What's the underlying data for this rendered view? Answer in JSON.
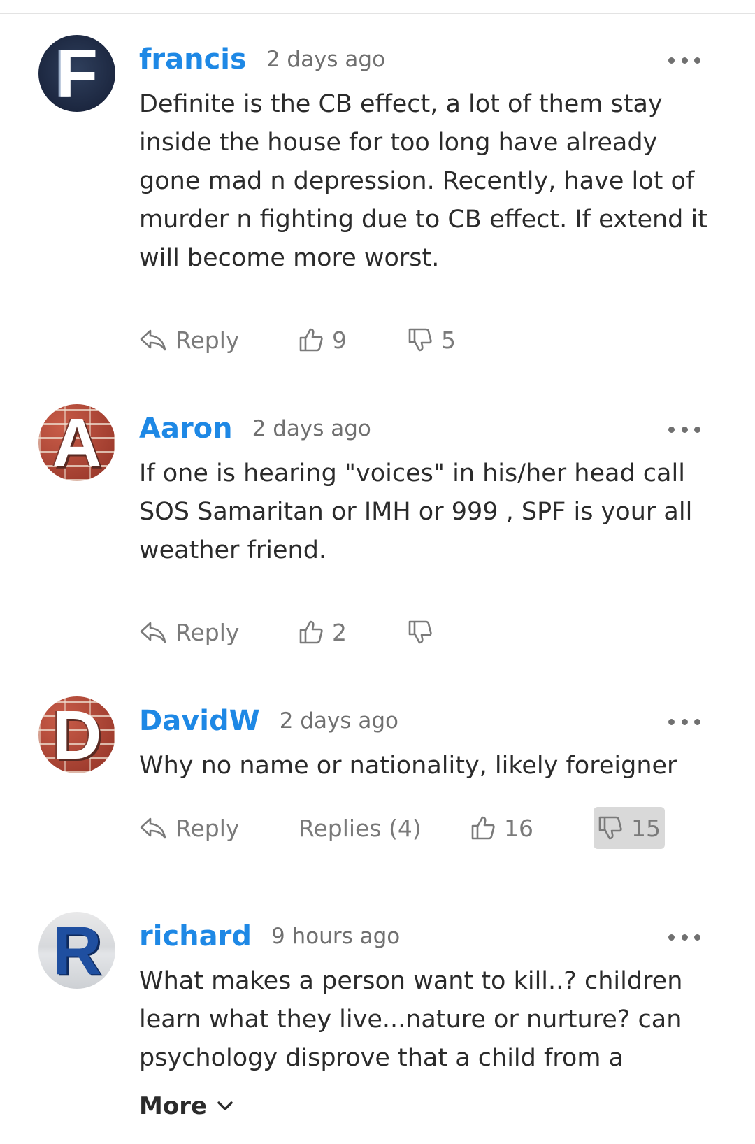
{
  "comments": [
    {
      "avatar_letter": "F",
      "username": "francis",
      "timestamp": "2 days ago",
      "text": "Definite is the CB effect, a lot of them stay inside the house for too long have already gone mad n depression. Recently, have lot of murder n fighting due to CB effect. If extend it will become more worst.",
      "reply_label": "Reply",
      "likes": "9",
      "dislikes": "5"
    },
    {
      "avatar_letter": "A",
      "username": "Aaron",
      "timestamp": "2 days ago",
      "text": "If one is hearing \"voices\" in his/her head call SOS Samaritan or IMH or 999 , SPF is your all weather friend.",
      "reply_label": "Reply",
      "likes": "2",
      "dislikes": ""
    },
    {
      "avatar_letter": "D",
      "username": "DavidW",
      "timestamp": "2 days ago",
      "text": "Why no name or nationality, likely foreigner",
      "reply_label": "Reply",
      "replies_label": "Replies (4)",
      "likes": "16",
      "dislikes": "15"
    },
    {
      "avatar_letter": "R",
      "username": "richard",
      "timestamp": "9 hours ago",
      "text": "What makes a person want to kill..? children learn what they live...nature or nurture? can psychology disprove that a child from a",
      "more_label": "More"
    }
  ],
  "icons": {
    "reply": "reply-arrow-icon",
    "like": "thumbs-up-icon",
    "dislike": "thumbs-down-icon",
    "menu": "more-dots-icon",
    "chevron": "chevron-down-icon"
  },
  "colors": {
    "username": "#1e88e5",
    "meta": "#707070",
    "text": "#2b2b2b",
    "active_dislike_bg": "#d9d9d9"
  }
}
